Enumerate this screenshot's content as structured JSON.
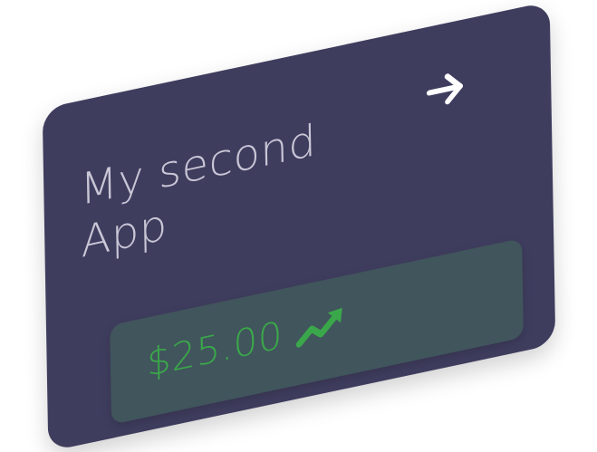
{
  "card": {
    "title": "My second\nApp",
    "price": "$25.00",
    "icons": {
      "navigate": "arrow-right-icon",
      "trend": "trending-up-icon"
    },
    "colors": {
      "card_bg": "#3f3d5e",
      "title_text": "#c9c6d6",
      "value_box_bg": "#41555c",
      "accent_green": "#3aa84a",
      "arrow_white": "#ffffff"
    }
  }
}
